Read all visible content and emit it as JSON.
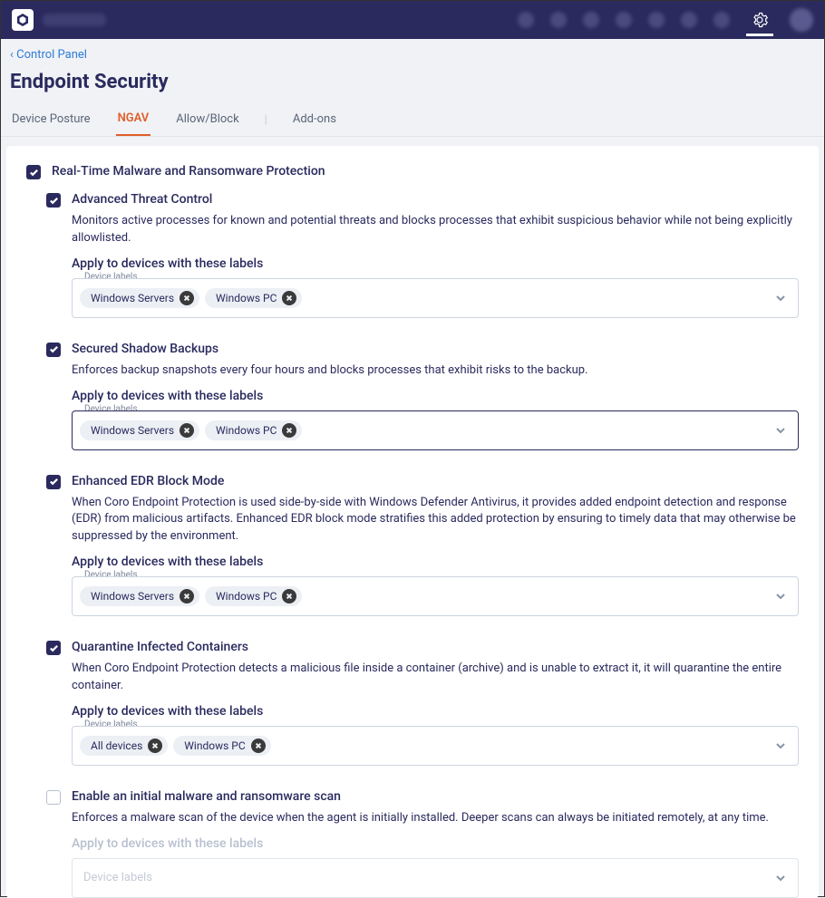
{
  "breadcrumb": {
    "back_symbol": "‹ ",
    "label": "Control Panel"
  },
  "page_title": "Endpoint Security",
  "tabs": [
    {
      "label": "Device Posture",
      "active": false
    },
    {
      "label": "NGAV",
      "active": true
    },
    {
      "label": "Allow/Block",
      "active": false
    },
    {
      "label": "Add-ons",
      "active": false
    }
  ],
  "main": {
    "title": "Real-Time Malware and Ransomware Protection",
    "checked": true
  },
  "apply_label": "Apply to devices with these labels",
  "field_caption": "Device labels",
  "field_placeholder": "Device labels",
  "sections": [
    {
      "key": "atc",
      "title": "Advanced Threat Control",
      "checked": true,
      "desc": "Monitors active processes for known and potential threats and blocks processes that exhibit suspicious behavior while not being explicitly allowlisted.",
      "chips": [
        "Windows Servers",
        "Windows PC"
      ],
      "active_border": false,
      "disabled": false
    },
    {
      "key": "ssb",
      "title": "Secured Shadow Backups",
      "checked": true,
      "desc": "Enforces backup snapshots every four hours and blocks processes that exhibit risks to the backup.",
      "chips": [
        "Windows Servers",
        "Windows PC"
      ],
      "active_border": true,
      "disabled": false
    },
    {
      "key": "edr",
      "title": "Enhanced EDR Block Mode",
      "checked": true,
      "desc": "When Coro Endpoint Protection is used side-by-side with Windows Defender Antivirus, it provides added endpoint detection and response (EDR) from malicious artifacts. Enhanced EDR block mode stratifies this added protection by ensuring to timely data that may otherwise be suppressed by the environment.",
      "chips": [
        "Windows Servers",
        "Windows PC"
      ],
      "active_border": false,
      "disabled": false
    },
    {
      "key": "qic",
      "title": "Quarantine Infected Containers",
      "checked": true,
      "desc": "When Coro Endpoint Protection detects a malicious file inside a container (archive) and is unable to extract it, it will quarantine the entire container.",
      "chips": [
        "All devices",
        "Windows PC"
      ],
      "active_border": false,
      "disabled": false
    },
    {
      "key": "initscan",
      "title": "Enable an initial malware and ransomware scan",
      "checked": false,
      "desc": "Enforces a malware scan of the device when the agent is initially installed. Deeper scans can always be initiated remotely, at any time.",
      "chips": [],
      "active_border": false,
      "disabled": true
    }
  ]
}
